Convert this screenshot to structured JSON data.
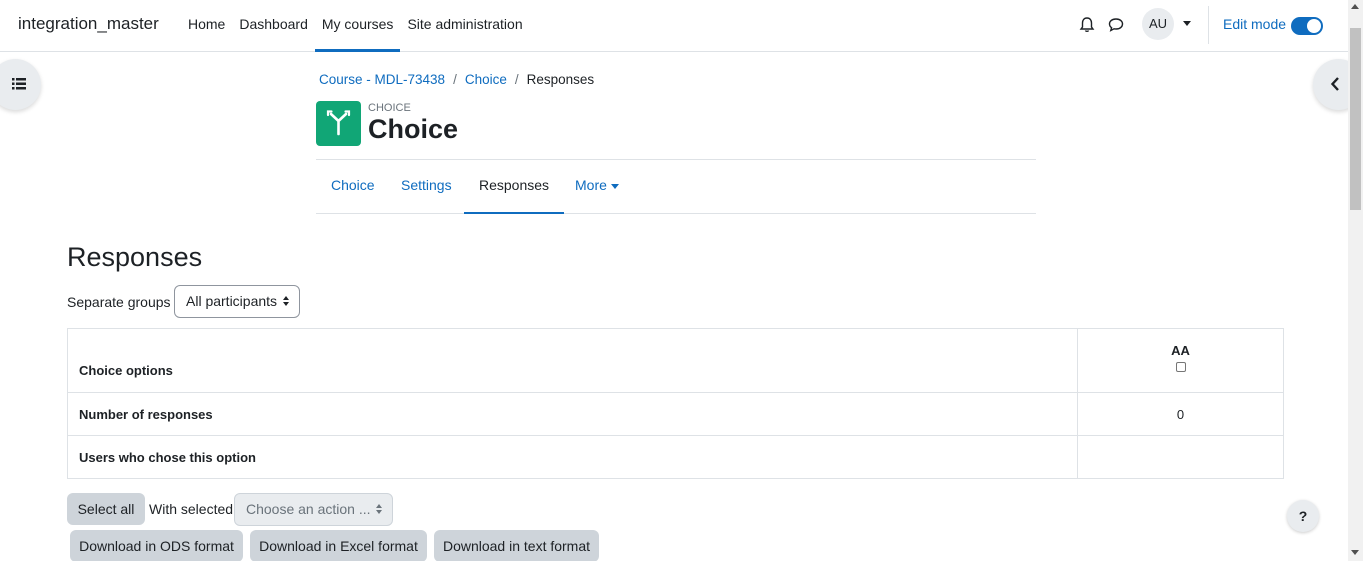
{
  "navbar": {
    "brand": "integration_master",
    "links": [
      "Home",
      "Dashboard",
      "My courses",
      "Site administration"
    ],
    "active_link": "My courses",
    "user_initials": "AU",
    "edit_mode_label": "Edit mode",
    "edit_mode_on": true
  },
  "breadcrumb": {
    "course": "Course - MDL-73438",
    "activity": "Choice",
    "current": "Responses"
  },
  "activity_header": {
    "pretitle": "CHOICE",
    "title": "Choice",
    "icon_color": "#11a676"
  },
  "secondary_nav": {
    "tabs": [
      "Choice",
      "Settings",
      "Responses",
      "More"
    ],
    "active_tab": "Responses"
  },
  "main": {
    "heading": "Responses",
    "group_label": "Separate groups",
    "group_select": "All participants",
    "table": {
      "header_label": "Choice options",
      "option_name": "AA",
      "responses_label": "Number of responses",
      "responses_value": "0",
      "users_label": "Users who chose this option"
    },
    "select_all": "Select all",
    "with_selected": "With selected",
    "action_placeholder": "Choose an action ...",
    "downloads": [
      "Download in ODS format",
      "Download in Excel format",
      "Download in text format"
    ]
  },
  "help": "?",
  "colors": {
    "primary": "#0f6cbf",
    "activity_green": "#11a676"
  }
}
